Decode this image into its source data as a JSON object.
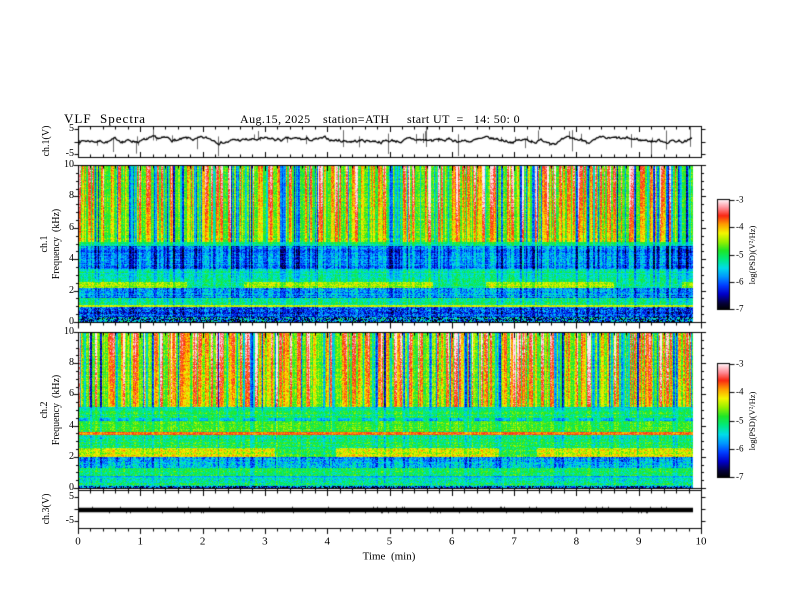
{
  "header": {
    "title": "VLF  Spectra",
    "date": "Aug.15, 2025",
    "station": "station=ATH",
    "start_ut": "start UT  =   14: 50: 0"
  },
  "xaxis": {
    "label": "Time  (min)",
    "ticks": [
      0,
      1,
      2,
      3,
      4,
      5,
      6,
      7,
      8,
      9,
      10
    ],
    "minor_step": 0.2,
    "range_min": [
      0,
      10
    ],
    "data_end_min": 9.87
  },
  "colorbars": [
    {
      "label": "log(PSD)(V²/Hz)",
      "ticks": [
        "-3",
        "-4",
        "-5",
        "-6",
        "-7"
      ],
      "lim": [
        -7,
        -3
      ],
      "colormap": "rainbow black→blue→cyan→green→yellow→red→white"
    },
    {
      "label": "log(PSD)(V²/Hz)",
      "ticks": [
        "-3",
        "-4",
        "-5",
        "-6",
        "-7"
      ],
      "lim": [
        -7,
        -3
      ],
      "colormap": "rainbow black→blue→cyan→green→yellow→red→white"
    }
  ],
  "chart_data": [
    {
      "type": "line",
      "panel": "ch1_waveform",
      "ylabel": "ch.1(V)",
      "ylim": [
        -5,
        5
      ],
      "ytick_labels": [
        "5",
        "-5"
      ],
      "xlim": [
        0,
        10
      ],
      "description": "Noisy VLF channel-1 voltage trace near 0 V with dense impulsive bipolar sferic spikes reaching ±5 V",
      "signal": {
        "baseline_v": 0.35,
        "noise_v": 0.5,
        "spike_prob": 0.085,
        "spike_amp_v": [
          0.7,
          5.0
        ]
      }
    },
    {
      "type": "heatmap",
      "panel": "ch1_spectrogram",
      "ylabel_ch": "ch.1",
      "ylabel_freq": "Frequency  (kHz)",
      "ylim": [
        0,
        10
      ],
      "yticks": [
        0,
        2,
        4,
        6,
        8,
        10
      ],
      "y_minor_step": 0.5,
      "value_range_log_psd": [
        -7,
        -3
      ],
      "stripes": {
        "bright_prob": 0.28,
        "dark_prob": 0.15,
        "note": "vertical sferic streaks through all bands, red tops"
      },
      "bands": [
        {
          "f": [
            5.15,
            10.0
          ],
          "v": 0.56,
          "n": 0.06,
          "s": 0.32,
          "row": 0.03,
          "tb": 0.26,
          "note": "green background, yellow/orange/red sferic stripes, dark streaks"
        },
        {
          "f": [
            4.9,
            5.15
          ],
          "v": 0.43,
          "n": 0.05,
          "s": 0.1,
          "row": 0.05,
          "note": "dark transition line ~5 kHz"
        },
        {
          "f": [
            3.4,
            4.9
          ],
          "v": 0.26,
          "n": 0.09,
          "s": 0.16,
          "row": 0.05,
          "note": "dark blue band, strong vertical texture"
        },
        {
          "f": [
            3.16,
            3.4
          ],
          "v": 0.42,
          "n": 0.07,
          "s": 0.1,
          "row": 0.05,
          "note": "cyan band"
        },
        {
          "f": [
            3.06,
            3.16
          ],
          "v": 0.33,
          "n": 0.05,
          "s": 0.08,
          "row": 0.04,
          "note": "thin dark line ~3.1 kHz"
        },
        {
          "f": [
            2.55,
            3.06
          ],
          "v": 0.42,
          "n": 0.07,
          "s": 0.1,
          "row": 0.05,
          "note": "cyan band"
        },
        {
          "f": [
            2.2,
            2.55
          ],
          "v": 0.62,
          "n": 0.08,
          "s": 0.06,
          "row": 0.04,
          "dash": [
            90,
            200,
            25,
            70
          ],
          "bg": 0.44,
          "note": "intermittent yellow-green emission band ~2.3 kHz"
        },
        {
          "f": [
            1.55,
            2.2
          ],
          "v": 0.29,
          "n": 0.11,
          "s": 0.1,
          "row": 0.05,
          "note": "blue textured band"
        },
        {
          "f": [
            1.1,
            1.55
          ],
          "v": 0.44,
          "n": 0.08,
          "s": 0.08,
          "row": 0.04,
          "note": "cyan band"
        },
        {
          "f": [
            0.95,
            1.1
          ],
          "v": 0.64,
          "n": 0.06,
          "s": 0.03,
          "row": 0.03,
          "note": "thin green-yellow line ~1 kHz"
        },
        {
          "f": [
            0.3,
            0.95
          ],
          "v": 0.21,
          "n": 0.13,
          "s": 0.08,
          "row": 0.05,
          "note": "dark navy dense texture"
        },
        {
          "f": [
            0.0,
            0.3
          ],
          "v": 0.22,
          "n": 0.3,
          "s": 0.04,
          "row": 0.04,
          "note": "black bottom edge with multicolour speckle"
        }
      ]
    },
    {
      "type": "heatmap",
      "panel": "ch2_spectrogram",
      "ylabel_ch": "ch.2",
      "ylabel_freq": "Frequency  (kHz)",
      "ylim": [
        0,
        10
      ],
      "yticks": [
        0,
        2,
        4,
        6,
        8,
        10
      ],
      "y_minor_step": 0.5,
      "value_range_log_psd": [
        -7,
        -3
      ],
      "stripes": {
        "bright_prob": 0.3,
        "dark_prob": 0.15,
        "note": "vertical sferic streaks, navy dark streaks between"
      },
      "bands": [
        {
          "f": [
            5.2,
            10.0
          ],
          "v": 0.58,
          "n": 0.07,
          "s": 0.34,
          "row": 0.03,
          "tb": 0.2,
          "note": "bright green background, yellow/red sferics, navy streaks"
        },
        {
          "f": [
            5.0,
            5.2
          ],
          "v": 0.4,
          "n": 0.06,
          "s": 0.08,
          "row": 0.05,
          "note": "dark line ~5.1 kHz"
        },
        {
          "f": [
            4.5,
            5.0
          ],
          "v": 0.48,
          "n": 0.08,
          "s": 0.08,
          "row": 0.05,
          "note": "cyan-green speckle"
        },
        {
          "f": [
            4.35,
            4.5
          ],
          "v": 0.33,
          "n": 0.06,
          "s": 0.05,
          "row": 0.04,
          "dash": [
            8,
            18,
            5,
            12
          ],
          "bg": 0.48,
          "note": "dashed dark line ~4.4 kHz"
        },
        {
          "f": [
            3.62,
            4.35
          ],
          "v": 0.52,
          "n": 0.07,
          "s": 0.08,
          "row": 0.04,
          "note": "green band"
        },
        {
          "f": [
            3.42,
            3.62
          ],
          "v": 0.81,
          "n": 0.06,
          "s": 0.04,
          "row": 0.03,
          "note": "strong red-orange emission line ~3.5 kHz"
        },
        {
          "f": [
            2.55,
            3.42
          ],
          "v": 0.46,
          "n": 0.08,
          "s": 0.08,
          "row": 0.05,
          "note": "green-cyan speckle with faint striations"
        },
        {
          "f": [
            2.0,
            2.55
          ],
          "v": 0.66,
          "n": 0.09,
          "s": 0.06,
          "row": 0.05,
          "dash": [
            120,
            260,
            30,
            80
          ],
          "bg": 0.5,
          "note": "yellow-orange band with red segments ~2.2 kHz"
        },
        {
          "f": [
            1.3,
            2.0
          ],
          "v": 0.3,
          "n": 0.11,
          "s": 0.1,
          "row": 0.05,
          "note": "blue textured band"
        },
        {
          "f": [
            0.8,
            1.3
          ],
          "v": 0.48,
          "n": 0.08,
          "s": 0.06,
          "row": 0.04,
          "note": "green-cyan band"
        },
        {
          "f": [
            0.62,
            0.8
          ],
          "v": 0.32,
          "n": 0.05,
          "s": 0.04,
          "row": 0.04,
          "note": "dark line ~0.7 kHz"
        },
        {
          "f": [
            0.12,
            0.62
          ],
          "v": 0.44,
          "n": 0.1,
          "s": 0.05,
          "row": 0.05,
          "note": "cyan-green speckle"
        },
        {
          "f": [
            0.0,
            0.12
          ],
          "v": 0.18,
          "n": 0.25,
          "s": 0.04,
          "row": 0.04,
          "note": "dark bottom edge"
        }
      ]
    },
    {
      "type": "line",
      "panel": "ch3_waveform",
      "ylabel": "ch.3(V)",
      "ylim": [
        -5,
        5
      ],
      "ytick_labels": [
        "5",
        "-5"
      ],
      "xlim": [
        0,
        10
      ],
      "description": "Channel-3 voltage: constant flat thick black line at 0 V",
      "signal": {
        "constant_v": 0,
        "thickness_px": 4.5
      }
    }
  ]
}
